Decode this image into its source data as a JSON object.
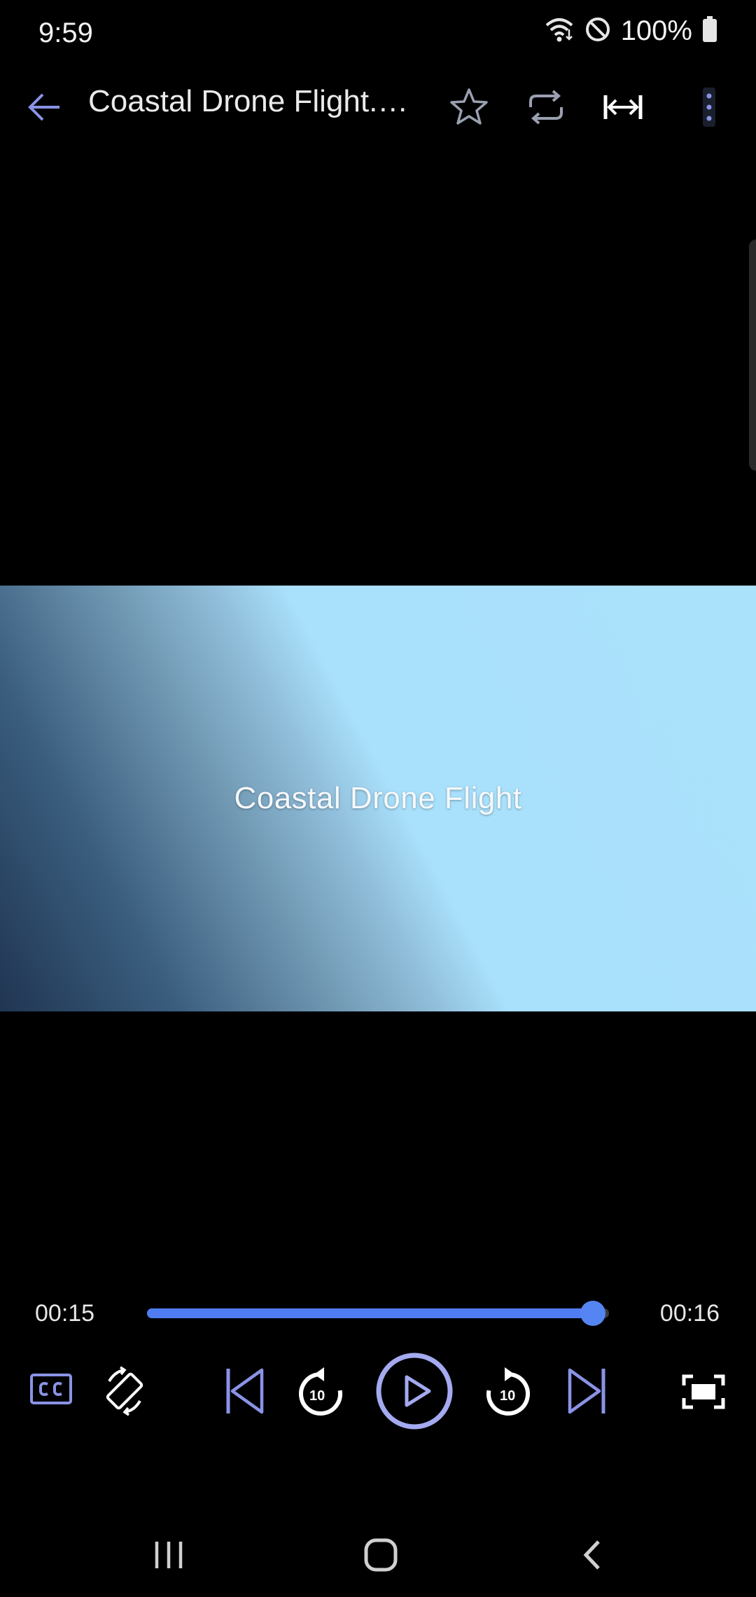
{
  "status_bar": {
    "time": "9:59",
    "battery": "100%",
    "icons": [
      "wifi-icon",
      "do-not-disturb-icon",
      "battery-icon"
    ]
  },
  "top_bar": {
    "title": "Coastal Drone Flight.mp4",
    "icons": [
      "back-arrow-icon",
      "star-icon",
      "repeat-icon",
      "fit-width-icon",
      "more-vert-icon"
    ]
  },
  "video": {
    "caption": "Coastal Drone Flight"
  },
  "playback": {
    "current_time": "00:15",
    "total_time": "00:16",
    "progress": 0.965
  },
  "controls": {
    "skip_back_label": "10",
    "skip_forward_label": "10",
    "icons": [
      "cc-icon",
      "rotate-screen-icon",
      "previous-icon",
      "replay-10-icon",
      "play-icon",
      "forward-10-icon",
      "next-icon",
      "fullscreen-icon"
    ]
  },
  "navigation": {
    "icons": [
      "recents-icon",
      "home-icon",
      "back-icon"
    ]
  },
  "colors": {
    "accent": "#4f7cf0",
    "control_purple": "#8a93e6",
    "background": "#000000"
  }
}
